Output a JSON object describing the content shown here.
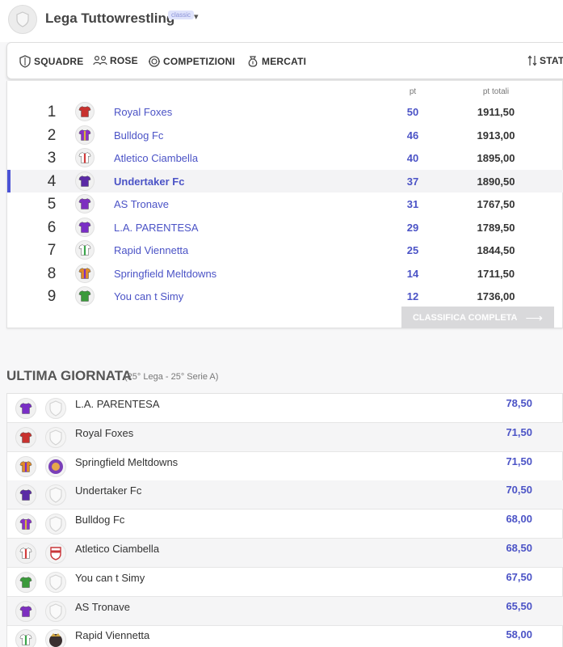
{
  "header": {
    "league_name": "Lega Tuttowrestling",
    "badge": "classic"
  },
  "nav": [
    {
      "label": "SQUADRE",
      "icon": "shield-icon"
    },
    {
      "label": "ROSE",
      "icon": "users-icon"
    },
    {
      "label": "COMPETIZIONI",
      "icon": "trophy-icon"
    },
    {
      "label": "MERCATI",
      "icon": "money-bag-icon"
    },
    {
      "label": "STAT",
      "icon": "sort-icon"
    }
  ],
  "standings": {
    "col_pt": "pt",
    "col_total": "pt totali",
    "rows": [
      {
        "rank": "1",
        "team": "Royal Foxes",
        "pt": "50",
        "total": "1911,50",
        "shirt": "#c8322f",
        "stripe": "#c8322f"
      },
      {
        "rank": "2",
        "team": "Bulldog Fc",
        "pt": "46",
        "total": "1913,00",
        "shirt": "#8a2fc9",
        "stripe": "#d6b53a"
      },
      {
        "rank": "3",
        "team": "Atletico Ciambella",
        "pt": "40",
        "total": "1895,00",
        "shirt": "#ffffff",
        "stripe": "#d23b3b"
      },
      {
        "rank": "4",
        "team": "Undertaker Fc",
        "pt": "37",
        "total": "1890,50",
        "shirt": "#5b2aa6",
        "stripe": "#5b2aa6"
      },
      {
        "rank": "5",
        "team": "AS Tronave",
        "pt": "31",
        "total": "1767,50",
        "shirt": "#7d2fc0",
        "stripe": "#7d2fc0"
      },
      {
        "rank": "6",
        "team": "L.A. PARENTESA",
        "pt": "29",
        "total": "1789,50",
        "shirt": "#7a2ec6",
        "stripe": "#7a2ec6"
      },
      {
        "rank": "7",
        "team": "Rapid Viennetta",
        "pt": "25",
        "total": "1844,50",
        "shirt": "#ffffff",
        "stripe": "#3aa64a"
      },
      {
        "rank": "8",
        "team": "Springfield Meltdowns",
        "pt": "14",
        "total": "1711,50",
        "shirt": "#e08a2a",
        "stripe": "#7a2ec6"
      },
      {
        "rank": "9",
        "team": "You can t Simy",
        "pt": "12",
        "total": "1736,00",
        "shirt": "#3a9a3a",
        "stripe": "#3a9a3a"
      }
    ],
    "highlight_rank": "4",
    "full_button": "CLASSIFICA COMPLETA"
  },
  "last_round": {
    "title": "ULTIMA GIORNATA",
    "subtitle": "(25° Lega - 25° Serie A)",
    "rows": [
      {
        "team": "L.A. PARENTESA",
        "score": "78,50",
        "shirt": "#7a2ec6",
        "stripe": "#7a2ec6",
        "logo": "placeholder"
      },
      {
        "team": "Royal Foxes",
        "score": "71,50",
        "shirt": "#c8322f",
        "stripe": "#c8322f",
        "logo": "placeholder"
      },
      {
        "team": "Springfield Meltdowns",
        "score": "71,50",
        "shirt": "#e08a2a",
        "stripe": "#7a2ec6",
        "logo": "purple-crest"
      },
      {
        "team": "Undertaker Fc",
        "score": "70,50",
        "shirt": "#5b2aa6",
        "stripe": "#5b2aa6",
        "logo": "placeholder"
      },
      {
        "team": "Bulldog Fc",
        "score": "68,00",
        "shirt": "#8a2fc9",
        "stripe": "#d6b53a",
        "logo": "placeholder"
      },
      {
        "team": "Atletico Ciambella",
        "score": "68,50",
        "shirt": "#ffffff",
        "stripe": "#d23b3b",
        "logo": "red-crest"
      },
      {
        "team": "You can t Simy",
        "score": "67,50",
        "shirt": "#3a9a3a",
        "stripe": "#3a9a3a",
        "logo": "placeholder"
      },
      {
        "team": "AS Tronave",
        "score": "65,50",
        "shirt": "#7d2fc0",
        "stripe": "#7d2fc0",
        "logo": "placeholder"
      },
      {
        "team": "Rapid Viennetta",
        "score": "58,00",
        "shirt": "#ffffff",
        "stripe": "#3aa64a",
        "logo": "dark-crest"
      }
    ]
  },
  "colors": {
    "accent": "#4b53c6",
    "highlight_bar": "#4b53d6"
  }
}
